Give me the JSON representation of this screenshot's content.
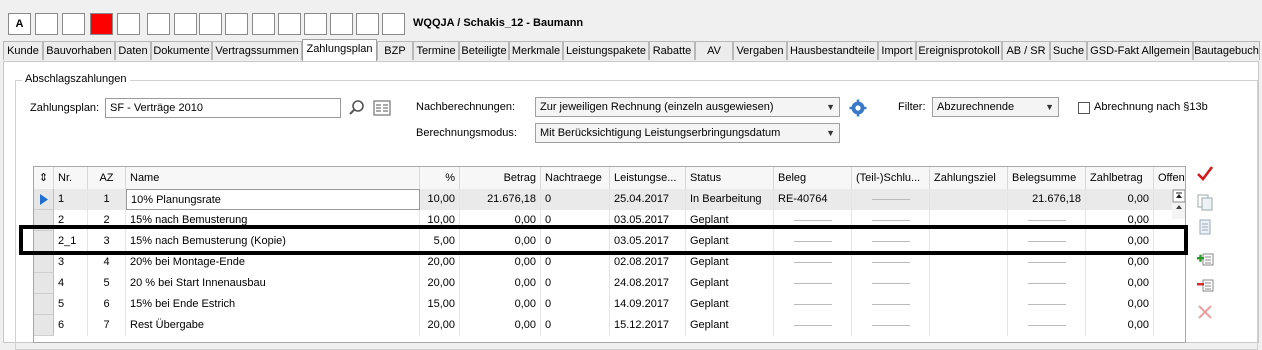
{
  "header": {
    "cell_label": "A",
    "title": "WQQJA / Schakis_12 - Baumann"
  },
  "tabs": [
    "Kunde",
    "Bauvorhaben",
    "Daten",
    "Dokumente",
    "Vertragssummen",
    "Zahlungsplan",
    "BZP",
    "Termine",
    "Beteiligte",
    "Merkmale",
    "Leistungspakete",
    "Rabatte",
    "AV",
    "Vergaben",
    "Hausbestandteile",
    "Import",
    "Ereignisprotokoll",
    "AB / SR",
    "Suche",
    "GSD-Fakt Allgemein",
    "Bautagebuch"
  ],
  "active_tab": "Zahlungsplan",
  "section": {
    "legend": "Abschlagszahlungen",
    "zahlungsplan_label": "Zahlungsplan:",
    "zahlungsplan_value": "SF - Verträge 2010",
    "nachberechnungen_label": "Nachberechnungen:",
    "nachberechnungen_value": "Zur jeweiligen Rechnung (einzeln ausgewiesen)",
    "berechnungsmodus_label": "Berechnungsmodus:",
    "berechnungsmodus_value": "Mit Berücksichtigung Leistungserbringungsdatum",
    "filter_label": "Filter:",
    "filter_value": "Abzurechnende",
    "checkbox_label": "Abrechnung nach §13b",
    "checkbox_checked": false
  },
  "table": {
    "columns": [
      "Nr.",
      "AZ",
      "Name",
      "%",
      "Betrag",
      "Nachtraege",
      "Leistungse...",
      "Status",
      "Beleg",
      "(Teil-)Schlu...",
      "Zahlungsziel",
      "Belegsumme",
      "Zahlbetrag",
      "Offen"
    ],
    "rows": [
      {
        "nr": "1",
        "az": "1",
        "name": "10% Planungsrate",
        "pct": "10,00",
        "betrag": "21.676,18",
        "nachtraege": "0",
        "datum": "25.04.2017",
        "status": "In Bearbeitung",
        "beleg": "RE-40764",
        "belegsumme": "21.676,18",
        "zahlbetrag": "0,00"
      },
      {
        "nr": "2",
        "az": "2",
        "name": "15% nach Bemusterung",
        "pct": "10,00",
        "betrag": "0,00",
        "nachtraege": "0",
        "datum": "03.05.2017",
        "status": "Geplant",
        "beleg": "",
        "belegsumme": "",
        "zahlbetrag": "0,00"
      },
      {
        "nr": "2_1",
        "az": "3",
        "name": "15% nach Bemusterung (Kopie)",
        "pct": "5,00",
        "betrag": "0,00",
        "nachtraege": "0",
        "datum": "03.05.2017",
        "status": "Geplant",
        "beleg": "",
        "belegsumme": "",
        "zahlbetrag": "0,00"
      },
      {
        "nr": "3",
        "az": "4",
        "name": "20% bei Montage-Ende",
        "pct": "20,00",
        "betrag": "0,00",
        "nachtraege": "0",
        "datum": "02.08.2017",
        "status": "Geplant",
        "beleg": "",
        "belegsumme": "",
        "zahlbetrag": "0,00"
      },
      {
        "nr": "4",
        "az": "5",
        "name": "20 % bei Start Innenausbau",
        "pct": "20,00",
        "betrag": "0,00",
        "nachtraege": "0",
        "datum": "24.08.2017",
        "status": "Geplant",
        "beleg": "",
        "belegsumme": "",
        "zahlbetrag": "0,00"
      },
      {
        "nr": "5",
        "az": "6",
        "name": "15% bei Ende Estrich",
        "pct": "15,00",
        "betrag": "0,00",
        "nachtraege": "0",
        "datum": "14.09.2017",
        "status": "Geplant",
        "beleg": "",
        "belegsumme": "",
        "zahlbetrag": "0,00"
      },
      {
        "nr": "6",
        "az": "7",
        "name": "Rest Übergabe",
        "pct": "20,00",
        "betrag": "0,00",
        "nachtraege": "0",
        "datum": "15.12.2017",
        "status": "Geplant",
        "beleg": "",
        "belegsumme": "",
        "zahlbetrag": "0,00"
      }
    ]
  },
  "colors": {
    "red_cell": "#ff0000",
    "checkmark": "#d41a1a",
    "add": "#2a9a2a",
    "remove": "#d42a2a",
    "gear": "#3a78c8"
  }
}
